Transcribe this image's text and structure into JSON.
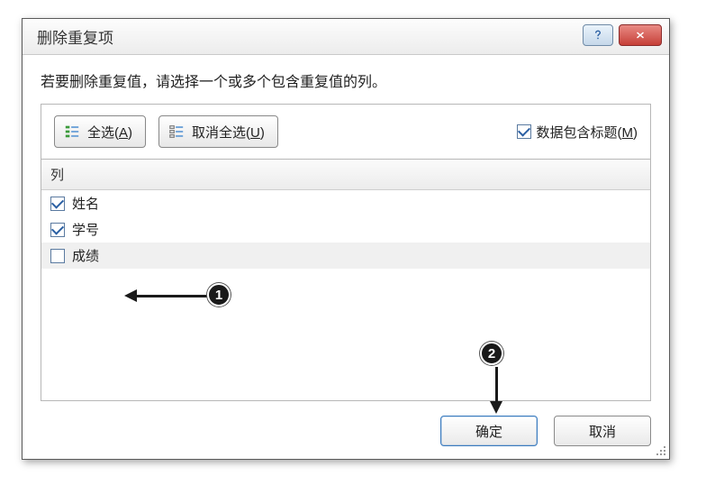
{
  "dialog": {
    "title": "删除重复项",
    "instruction": "若要删除重复值，请选择一个或多个包含重复值的列。"
  },
  "toolbar": {
    "select_all_prefix": "全选(",
    "select_all_key": "A",
    "select_all_suffix": ")",
    "deselect_all_prefix": "取消全选(",
    "deselect_all_key": "U",
    "deselect_all_suffix": ")",
    "header_check_prefix": "数据包含标题(",
    "header_check_key": "M",
    "header_check_suffix": ")",
    "header_checked": true
  },
  "columns": {
    "header": "列",
    "items": [
      {
        "label": "姓名",
        "checked": true,
        "selected": false
      },
      {
        "label": "学号",
        "checked": true,
        "selected": false
      },
      {
        "label": "成绩",
        "checked": false,
        "selected": true
      }
    ]
  },
  "buttons": {
    "ok": "确定",
    "cancel": "取消"
  },
  "annotations": {
    "c1": "1",
    "c2": "2"
  }
}
